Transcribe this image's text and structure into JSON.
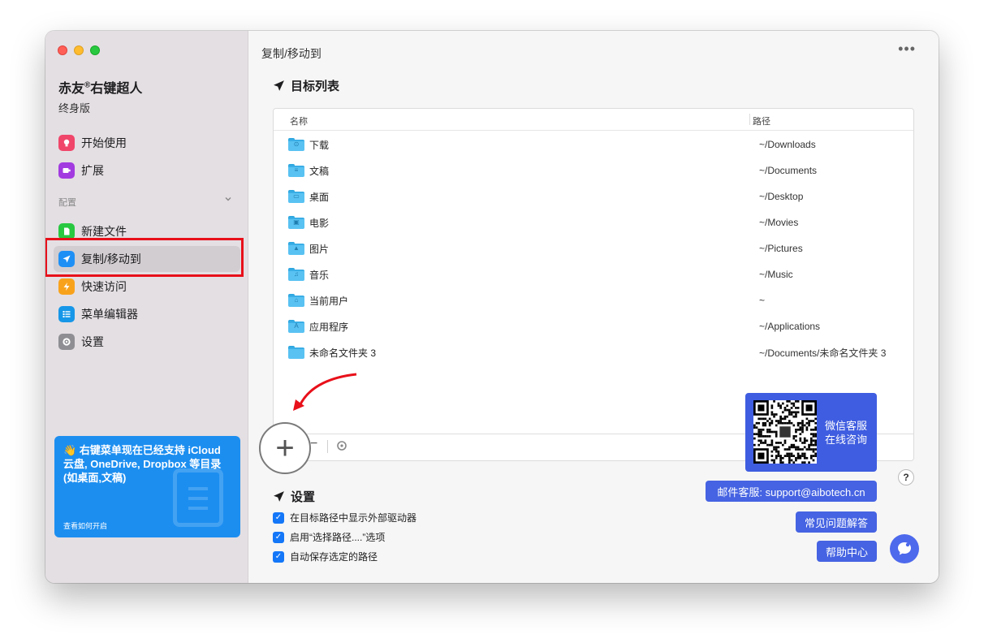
{
  "app": {
    "title_main": "赤友",
    "title_sup": "®",
    "title_rest": "右键超人",
    "edition": "终身版"
  },
  "sidebar": {
    "items": [
      {
        "label": "开始使用",
        "icon": "lightbulb-icon",
        "color": "#f0466a"
      },
      {
        "label": "扩展",
        "icon": "extension-icon",
        "color": "#a23be0"
      }
    ],
    "section_label": "配置",
    "config_items": [
      {
        "label": "新建文件",
        "icon": "new-file-icon",
        "color": "#28c840"
      },
      {
        "label": "复制/移动到",
        "icon": "send-icon",
        "color": "#1e8ff5",
        "active": true
      },
      {
        "label": "快速访问",
        "icon": "bolt-icon",
        "color": "#f8a21c"
      },
      {
        "label": "菜单编辑器",
        "icon": "list-icon",
        "color": "#1797e8"
      },
      {
        "label": "设置",
        "icon": "gear-icon",
        "color": "#8e8e93"
      }
    ]
  },
  "promo": {
    "emoji": "👋",
    "text": "右键菜单现在已经支持 iCloud 云盘, OneDrive, Dropbox 等目录 (如桌面,文稿)",
    "link": "查看如何开启"
  },
  "main": {
    "title": "复制/移动到",
    "more": "•••",
    "target_section": "目标列表",
    "columns": {
      "name": "名称",
      "path": "路径"
    },
    "rows": [
      {
        "name": "下载",
        "path": "~/Downloads",
        "glyph": "⊙"
      },
      {
        "name": "文稿",
        "path": "~/Documents",
        "glyph": "≡"
      },
      {
        "name": "桌面",
        "path": "~/Desktop",
        "glyph": "▭"
      },
      {
        "name": "电影",
        "path": "~/Movies",
        "glyph": "▣"
      },
      {
        "name": "图片",
        "path": "~/Pictures",
        "glyph": "▲"
      },
      {
        "name": "音乐",
        "path": "~/Music",
        "glyph": "♫"
      },
      {
        "name": "当前用户",
        "path": "~",
        "glyph": "⌂"
      },
      {
        "name": "应用程序",
        "path": "~/Applications",
        "glyph": "A"
      },
      {
        "name": "未命名文件夹 3",
        "path": "~/Documents/未命名文件夹 3",
        "glyph": ""
      }
    ],
    "toolbar": {
      "add": "+",
      "remove": "−",
      "action": "⚙"
    },
    "settings_section": "设置",
    "settings": [
      {
        "label": "在目标路径中显示外部驱动器",
        "checked": true
      },
      {
        "label": "启用“选择路径....”选项",
        "checked": true
      },
      {
        "label": "自动保存选定的路径",
        "checked": true
      }
    ]
  },
  "support": {
    "qr_line1": "微信客服",
    "qr_line2": "在线咨询",
    "email": "邮件客服: support@aibotech.cn",
    "faq": "常见问题解答",
    "help_center": "帮助中心",
    "question": "?"
  },
  "colors": {
    "highlight": "#e8101a",
    "accent_blue": "#4563e2",
    "arrow": "#e8101a"
  }
}
